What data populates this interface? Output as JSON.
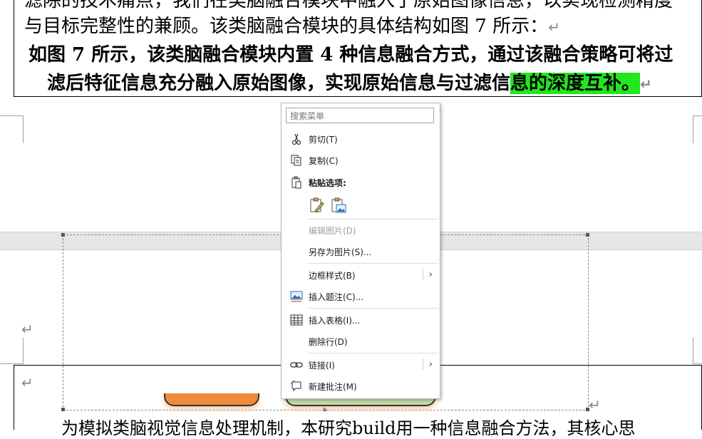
{
  "document": {
    "line1": "滤除的技术痛点，我们在类脑融合模块中融入了原始图像信息，以实现检测精度",
    "line2": "与目标完整性的兼顾。该类脑融合模块的具体结构如图 7 所示：",
    "line3": "如图 7 所示，该类脑融合模块内置 4 种信息融合方式，通过该融合策略可将过",
    "line4_main": "滤后特征信息充分融入原始图像，实现原始信息与过滤信",
    "line4_highlight": "息的深度互补。",
    "paragraph_mark": "↵",
    "bottom_line": "为模拟类脑视觉信息处理机制，本研究build用一种信息融合方法，其核心思"
  },
  "context_menu": {
    "search_placeholder": "搜索菜单",
    "items": [
      {
        "label": "剪切(T)",
        "icon": "scissors-icon",
        "enabled": true
      },
      {
        "label": "复制(C)",
        "icon": "copy-icon",
        "enabled": true
      },
      {
        "label": "粘贴选项:",
        "icon": "paste-icon",
        "enabled": true
      },
      {
        "label": "编辑图片(D)",
        "icon": "",
        "enabled": false
      },
      {
        "label": "另存为图片(S)...",
        "icon": "",
        "enabled": true
      },
      {
        "label": "边框样式(B)",
        "icon": "",
        "enabled": true,
        "submenu": true
      },
      {
        "label": "插入题注(C)...",
        "icon": "caption-icon",
        "enabled": true
      },
      {
        "label": "插入表格(I)...",
        "icon": "table-icon",
        "enabled": true
      },
      {
        "label": "删除行(D)",
        "icon": "",
        "enabled": true
      },
      {
        "label": "链接(I)",
        "icon": "link-icon",
        "enabled": true,
        "submenu": true
      },
      {
        "label": "新建批注(M)",
        "icon": "comment-icon",
        "enabled": true
      }
    ],
    "submenu_arrow": "›"
  },
  "colors": {
    "highlight": "#22e61e"
  }
}
